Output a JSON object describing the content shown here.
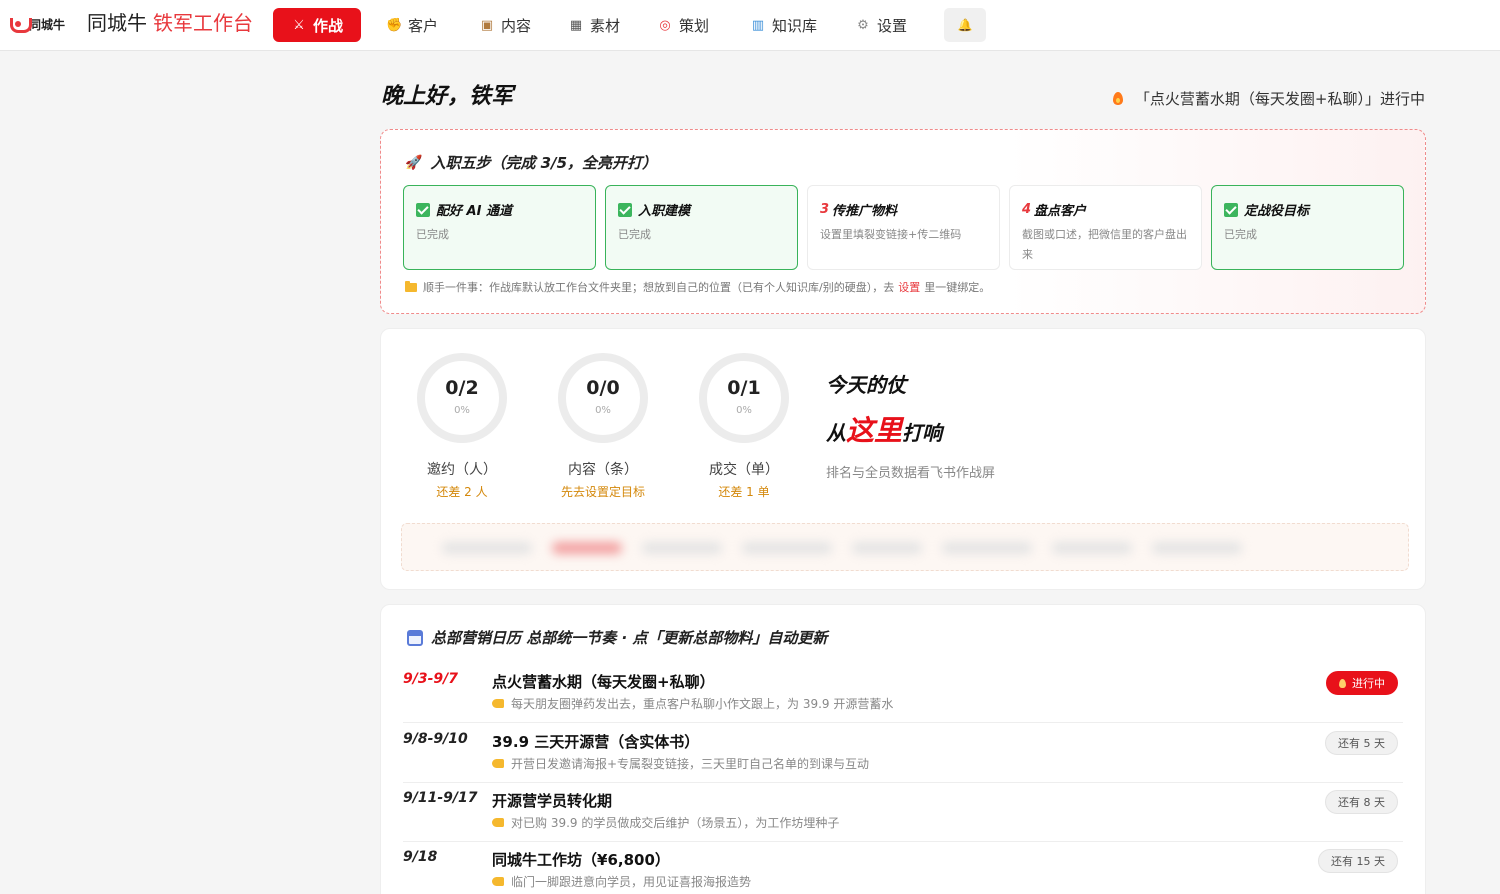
{
  "nav": {
    "logo_text": "同城牛",
    "brand_main": "同城牛",
    "brand_sub": "铁军工作台",
    "items": [
      {
        "label": "作战",
        "icon": "crossed-swords-icon",
        "glyph": "⚔",
        "active": true
      },
      {
        "label": "客户",
        "icon": "handshake-icon",
        "glyph": "✊",
        "active": false
      },
      {
        "label": "内容",
        "icon": "package-icon",
        "glyph": "▣",
        "active": false
      },
      {
        "label": "素材",
        "icon": "image-icon",
        "glyph": "▦",
        "active": false
      },
      {
        "label": "策划",
        "icon": "target-icon",
        "glyph": "◎",
        "active": false
      },
      {
        "label": "知识库",
        "icon": "books-icon",
        "glyph": "▥",
        "active": false
      },
      {
        "label": "设置",
        "icon": "gear-icon",
        "glyph": "⚙",
        "active": false
      }
    ],
    "bell_glyph": "🔔"
  },
  "header": {
    "greeting": "晚上好，铁军",
    "current_phase": "「点火营蓄水期（每天发圈+私聊）」进行中"
  },
  "onboarding": {
    "title": "入职五步（完成 3/5，全亮开打）",
    "steps": [
      {
        "num": "",
        "title": "配好 AI 通道",
        "desc": "已完成",
        "done": true
      },
      {
        "num": "",
        "title": "入职建模",
        "desc": "已完成",
        "done": true
      },
      {
        "num": "3",
        "title": "传推广物料",
        "desc": "设置里填裂变链接+传二维码",
        "done": false
      },
      {
        "num": "4",
        "title": "盘点客户",
        "desc": "截图或口述，把微信里的客户盘出来",
        "done": false
      },
      {
        "num": "",
        "title": "定战役目标",
        "desc": "已完成",
        "done": true
      }
    ],
    "note_before": "顺手一件事：作战库默认放工作台文件夹里；想放到自己的位置（已有个人知识库/别的硬盘），去",
    "note_link": "设置",
    "note_after": "里一键绑定。"
  },
  "stats": {
    "metrics": [
      {
        "value": "0/2",
        "percent": "0%",
        "progress": 0,
        "label": "邀约（人）",
        "hint": "还差 2 人"
      },
      {
        "value": "0/0",
        "percent": "0%",
        "progress": 0,
        "label": "内容（条）",
        "hint": "先去设置定目标"
      },
      {
        "value": "0/1",
        "percent": "0%",
        "progress": 0,
        "label": "成交（单）",
        "hint": "还差 1 单"
      }
    ],
    "slogan_line1": "今天的仗",
    "slogan_pre": "从",
    "slogan_highlight": "这里",
    "slogan_post": "打响",
    "slogan_sub": "排名与全员数据看飞书作战屏",
    "colors": {
      "ring_track": "#ececec",
      "ring_fill": "#e8111a"
    }
  },
  "calendar": {
    "title": "总部营销日历 总部统一节奏 · 点「更新总部物料」自动更新",
    "rows": [
      {
        "date": "9/3-9/7",
        "title": "点火营蓄水期（每天发圈+私聊）",
        "desc": "每天朋友圈弹药发出去，重点客户私聊小作文跟上，为 39.9 开源营蓄水",
        "badge": "进行中",
        "current": true
      },
      {
        "date": "9/8-9/10",
        "title": "39.9 三天开源营（含实体书）",
        "desc": "开营日发邀请海报+专属裂变链接，三天里盯自己名单的到课与互动",
        "badge": "还有 5 天",
        "current": false
      },
      {
        "date": "9/11-9/17",
        "title": "开源营学员转化期",
        "desc": "对已购 39.9 的学员做成交后维护（场景五），为工作坊埋种子",
        "badge": "还有 8 天",
        "current": false
      },
      {
        "date": "9/18",
        "title": "同城牛工作坊（¥6,800）",
        "desc": "临门一脚跟进意向学员，用见证喜报海报造势",
        "badge": "还有 15 天",
        "current": false
      }
    ]
  },
  "theme": {
    "accent": "#e8111a",
    "success": "#3cb55d",
    "warning": "#d4880b"
  }
}
